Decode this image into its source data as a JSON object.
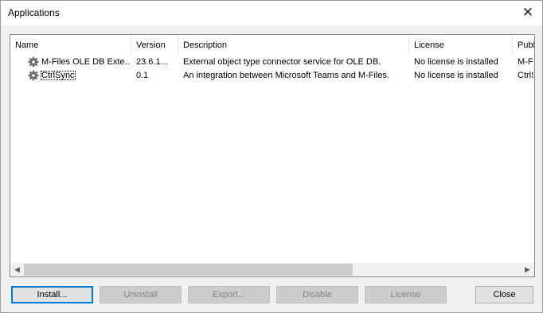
{
  "window": {
    "title": "Applications"
  },
  "columns": [
    "Name",
    "Version",
    "Description",
    "License",
    "Publ"
  ],
  "rows": [
    {
      "icon": "gear-icon",
      "name": "M-Files OLE DB Exte...",
      "version": "23.6.1...",
      "description": "External object type connector service for OLE DB.",
      "license": "No license is installed",
      "publisher": "M-Fil"
    },
    {
      "icon": "gear-icon",
      "name": "CtrlSync",
      "version": "0.1",
      "description": "An integration between Microsoft Teams and M-Files.",
      "license": "No license is installed",
      "publisher": "CtrlS"
    }
  ],
  "buttons": {
    "install": "Install...",
    "uninstall": "Uninstall",
    "export": "Export...",
    "disable": "Disable",
    "license": "License",
    "close": "Close"
  },
  "colors": {
    "accent": "#0078d7",
    "disabled_bg": "#cccccc",
    "disabled_text": "#838383"
  }
}
